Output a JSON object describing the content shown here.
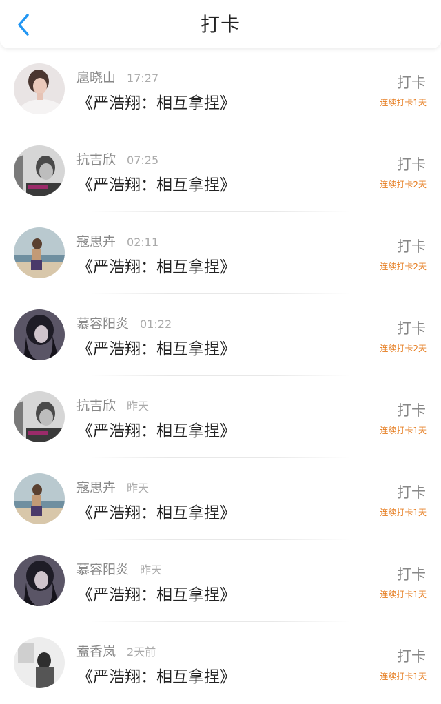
{
  "header": {
    "title": "打卡",
    "back_icon": "chevron-left-icon",
    "accent_color": "#2196f3"
  },
  "items": [
    {
      "name": "扈晓山",
      "time": "17:27",
      "title": "《严浩翔：相互拿捏》",
      "action": "打卡",
      "streak": "连续打卡1天",
      "avatar": "female-portrait"
    },
    {
      "name": "抗吉欣",
      "time": "07:25",
      "title": "《严浩翔：相互拿捏》",
      "action": "打卡",
      "streak": "连续打卡2天",
      "avatar": "young-man-portrait"
    },
    {
      "name": "寇思卉",
      "time": "02:11",
      "title": "《严浩翔：相互拿捏》",
      "action": "打卡",
      "streak": "连续打卡2天",
      "avatar": "beach-figure"
    },
    {
      "name": "慕容阳炎",
      "time": "01:22",
      "title": "《严浩翔：相互拿捏》",
      "action": "打卡",
      "streak": "连续打卡2天",
      "avatar": "anime-girl"
    },
    {
      "name": "抗吉欣",
      "time": "昨天",
      "title": "《严浩翔：相互拿捏》",
      "action": "打卡",
      "streak": "连续打卡1天",
      "avatar": "young-man-portrait"
    },
    {
      "name": "寇思卉",
      "time": "昨天",
      "title": "《严浩翔：相互拿捏》",
      "action": "打卡",
      "streak": "连续打卡1天",
      "avatar": "beach-figure"
    },
    {
      "name": "慕容阳炎",
      "time": "昨天",
      "title": "《严浩翔：相互拿捏》",
      "action": "打卡",
      "streak": "连续打卡1天",
      "avatar": "anime-girl"
    },
    {
      "name": "盍香岚",
      "time": "2天前",
      "title": "《严浩翔：相互拿捏》",
      "action": "打卡",
      "streak": "连续打卡1天",
      "avatar": "bw-room"
    }
  ]
}
